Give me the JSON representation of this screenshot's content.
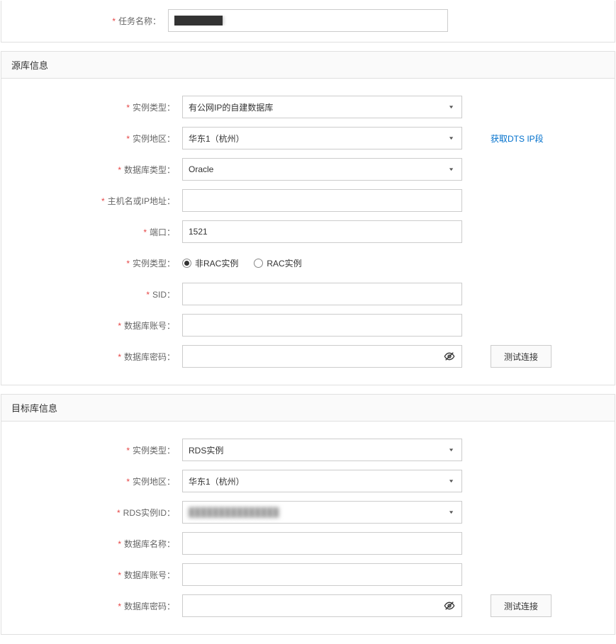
{
  "top": {
    "task_name_label": "任务名称：",
    "task_name_value": "████████"
  },
  "source": {
    "header": "源库信息",
    "instance_type_label": "实例类型：",
    "instance_type_value": "有公网IP的自建数据库",
    "instance_region_label": "实例地区：",
    "instance_region_value": "华东1（杭州）",
    "dts_ip_link": "获取DTS IP段",
    "db_type_label": "数据库类型：",
    "db_type_value": "Oracle",
    "host_label": "主机名或IP地址：",
    "host_value": "",
    "port_label": "端口：",
    "port_value": "1521",
    "rac_label": "实例类型：",
    "rac_opt1": "非RAC实例",
    "rac_opt2": "RAC实例",
    "rac_selected": "non-rac",
    "sid_label": "SID：",
    "sid_value": "",
    "db_account_label": "数据库账号：",
    "db_account_value": "",
    "db_password_label": "数据库密码：",
    "db_password_value": "",
    "test_btn": "测试连接"
  },
  "target": {
    "header": "目标库信息",
    "instance_type_label": "实例类型：",
    "instance_type_value": "RDS实例",
    "instance_region_label": "实例地区：",
    "instance_region_value": "华东1（杭州）",
    "rds_id_label": "RDS实例ID：",
    "rds_id_value": "███████████████",
    "db_name_label": "数据库名称：",
    "db_name_value": "",
    "db_account_label": "数据库账号：",
    "db_account_value": "",
    "db_password_label": "数据库密码：",
    "db_password_value": "",
    "test_btn": "测试连接"
  }
}
